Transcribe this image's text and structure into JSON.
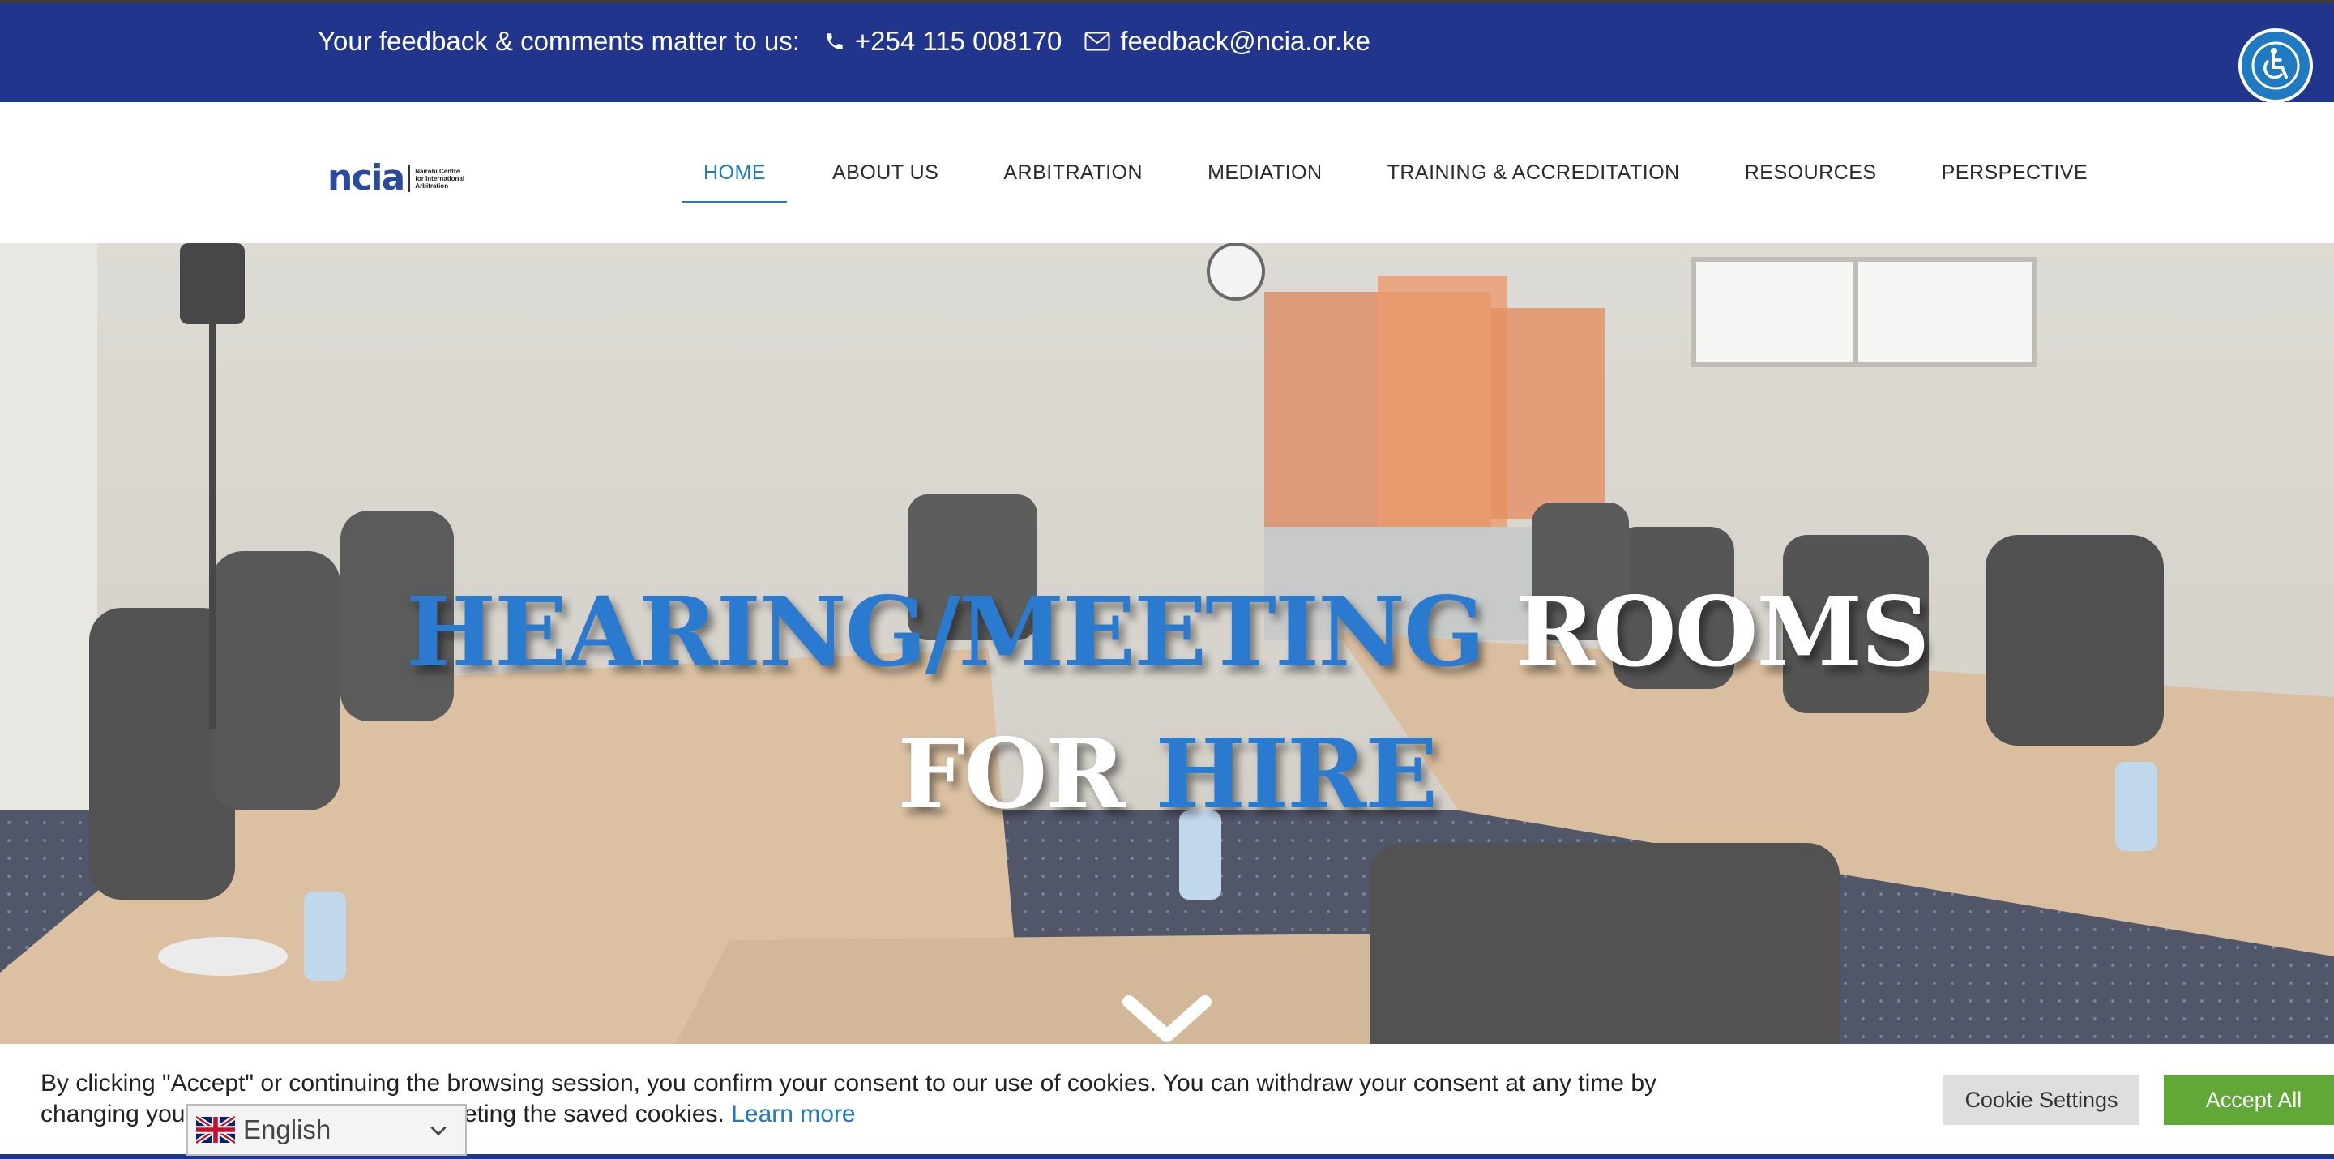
{
  "topbar": {
    "message": "Your feedback & comments matter to us:",
    "phone": "+254 115 008170",
    "email": "feedback@ncia.or.ke",
    "background": "#22358c"
  },
  "logo": {
    "mark": "ncia",
    "line1": "Nairobi Centre",
    "line2": "for International",
    "line3": "Arbitration"
  },
  "nav": {
    "items": [
      {
        "label": "HOME",
        "active": true
      },
      {
        "label": "ABOUT US"
      },
      {
        "label": "ARBITRATION"
      },
      {
        "label": "MEDIATION"
      },
      {
        "label": "TRAINING & ACCREDITATION"
      },
      {
        "label": "RESOURCES"
      },
      {
        "label": "PERSPECTIVE"
      }
    ],
    "accent": "#1f7ac2"
  },
  "hero": {
    "title_part1": "HEARING/MEETING",
    "title_part2": " ROOMS",
    "title_part3": "FOR ",
    "title_part4": "HIRE"
  },
  "cookie": {
    "text": "By clicking \"Accept\" or continuing the browsing session, you confirm your consent to our use of cookies. You can withdraw your consent at any time by changing your browser settings and deleting the saved cookies.",
    "learn_more": "Learn more",
    "settings_label": "Cookie Settings",
    "accept_label": "Accept All",
    "accept_color": "#62a839"
  },
  "language": {
    "selected": "English"
  },
  "icons": [
    "phone-icon",
    "mail-icon",
    "accessibility-icon",
    "uk-flag-icon",
    "chevron-down-icon"
  ]
}
